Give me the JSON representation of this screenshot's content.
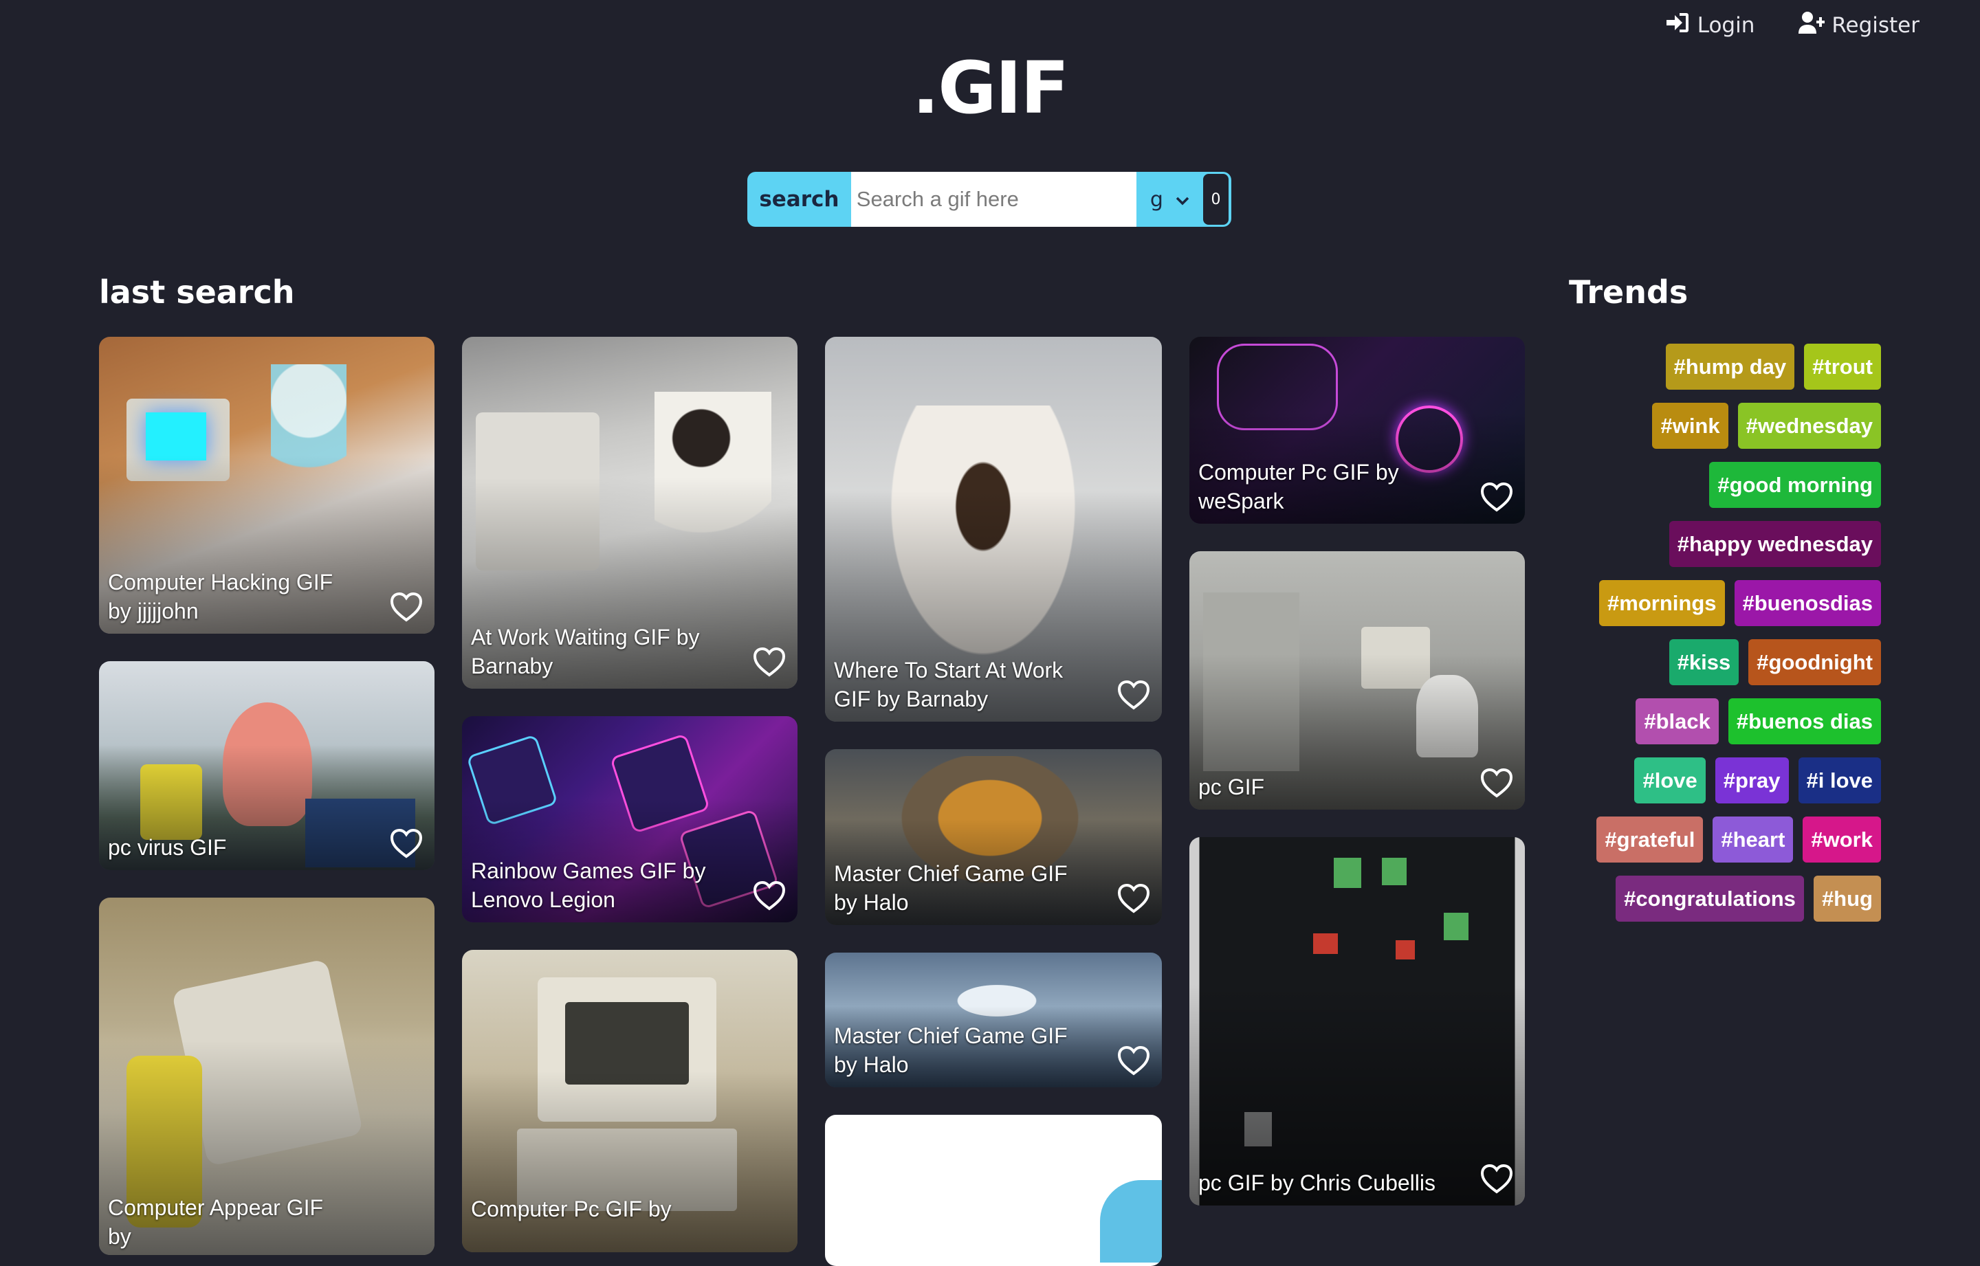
{
  "header": {
    "login_label": "Login",
    "register_label": "Register",
    "logo": ".GIF"
  },
  "search": {
    "button_label": "search",
    "placeholder": "Search a gif here",
    "rating_value": "g",
    "count": "0"
  },
  "last_search": {
    "title": "last search",
    "cards": [
      {
        "title": "Computer Hacking GIF by jjjjjohn"
      },
      {
        "title": "pc virus GIF"
      },
      {
        "title": "Computer Appear GIF by"
      },
      {
        "title": "At Work Waiting GIF by Barnaby"
      },
      {
        "title": "Rainbow Games GIF by Lenovo Legion"
      },
      {
        "title": "Computer Pc GIF by"
      },
      {
        "title": "Where To Start At Work GIF by Barnaby"
      },
      {
        "title": "Master Chief Game GIF by Halo"
      },
      {
        "title": "Master Chief Game GIF by Halo"
      },
      {
        "title": ""
      },
      {
        "title": "Computer Pc GIF by weSpark"
      },
      {
        "title": "pc GIF"
      },
      {
        "title": "pc GIF by Chris Cubellis"
      }
    ]
  },
  "trends": {
    "title": "Trends",
    "tags": [
      {
        "label": "#hump day",
        "color": "#b59a1a"
      },
      {
        "label": "#trout",
        "color": "#a5c61a"
      },
      {
        "label": "#wink",
        "color": "#b98c10"
      },
      {
        "label": "#wednesday",
        "color": "#8ac425"
      },
      {
        "label": "#good morning",
        "color": "#1eb83a"
      },
      {
        "label": "#happy wednesday",
        "color": "#6a0e5c"
      },
      {
        "label": "#mornings",
        "color": "#c99a12"
      },
      {
        "label": "#buenosdias",
        "color": "#9b17a8"
      },
      {
        "label": "#kiss",
        "color": "#1aaa6c"
      },
      {
        "label": "#goodnight",
        "color": "#b7551c"
      },
      {
        "label": "#black",
        "color": "#b24fae"
      },
      {
        "label": "#buenos dias",
        "color": "#1dc12d"
      },
      {
        "label": "#love",
        "color": "#2ebf86"
      },
      {
        "label": "#pray",
        "color": "#7a33d6"
      },
      {
        "label": "#i love",
        "color": "#1a2f86"
      },
      {
        "label": "#grateful",
        "color": "#c96f66"
      },
      {
        "label": "#heart",
        "color": "#8d5ad8"
      },
      {
        "label": "#work",
        "color": "#d6178a"
      },
      {
        "label": "#congratulations",
        "color": "#7a2b7f"
      },
      {
        "label": "#hug",
        "color": "#c48f52"
      }
    ]
  }
}
